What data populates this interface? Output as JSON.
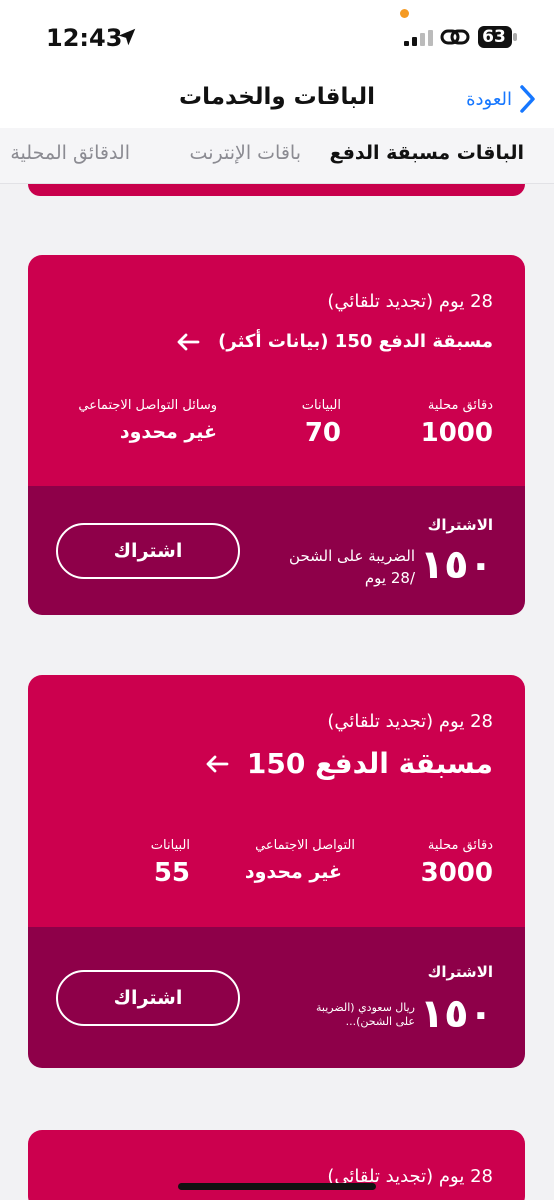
{
  "status_bar": {
    "time": "12:43",
    "battery": "63"
  },
  "header": {
    "title": "الباقات والخدمات",
    "back_label": "العودة"
  },
  "tabs": [
    {
      "label": "الباقات مسبقة الدفع",
      "active": true
    },
    {
      "label": "باقات الإنترنت",
      "active": false
    },
    {
      "label": "الدقائق المحلية",
      "active": false
    }
  ],
  "colors": {
    "card_top": "#cc004e",
    "card_bottom": "#8e0049",
    "link": "#1677ff"
  },
  "cards": [
    {
      "renewal": "28 يوم (تجديد تلقائي)",
      "name": "مسبقة الدفع 150 (بيانات أكثر)",
      "stats": [
        {
          "label": "دقائق محلية",
          "value": "1000"
        },
        {
          "label": "البيانات",
          "value": "70"
        },
        {
          "label": "وسائل التواصل الاجتماعي",
          "value": "غير محدود"
        }
      ],
      "subscription_label": "الاشتراك",
      "price": "١٥٠",
      "price_note_1": "الضريبة على الشحن",
      "price_note_2": "/28 يوم",
      "button": "اشتراك"
    },
    {
      "renewal": "28 يوم (تجديد تلقائي)",
      "name": "مسبقة الدفع 150",
      "stats": [
        {
          "label": "دقائق محلية",
          "value": "3000"
        },
        {
          "label": "التواصل الاجتماعي",
          "value": "غير محدود"
        },
        {
          "label": "البيانات",
          "value": "55"
        }
      ],
      "subscription_label": "الاشتراك",
      "price": "١٥٠",
      "price_note_1": "ريال سعودي (الضريبة",
      "price_note_2": "على الشحن)...",
      "button": "اشتراك"
    },
    {
      "renewal": "28 يوم (تجديد تلقائي)"
    }
  ]
}
